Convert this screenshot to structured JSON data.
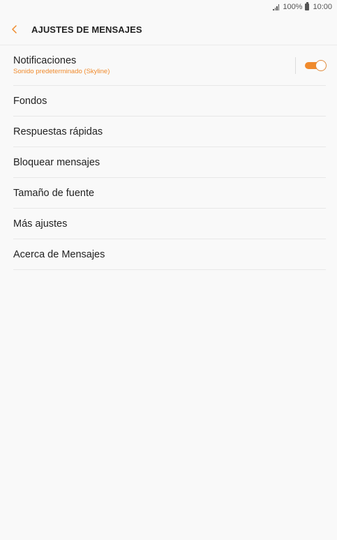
{
  "status_bar": {
    "battery": "100%",
    "time": "10:00",
    "signal_icon": "signal-bars-icon",
    "battery_icon": "battery-icon"
  },
  "header": {
    "title": "AJUSTES DE MENSAJES",
    "back_icon": "chevron-left-icon"
  },
  "settings": {
    "notifications": {
      "label": "Notificaciones",
      "subtitle": "Sonido predeterminado (Skyline)",
      "toggle_on": true
    },
    "items": [
      {
        "label": "Fondos"
      },
      {
        "label": "Respuestas rápidas"
      },
      {
        "label": "Bloquear mensajes"
      },
      {
        "label": "Tamaño de fuente"
      },
      {
        "label": "Más ajustes"
      },
      {
        "label": "Acerca de Mensajes"
      }
    ]
  },
  "colors": {
    "accent": "#f08a2c",
    "background": "#f9f9f9",
    "divider": "#e8e8e8"
  }
}
